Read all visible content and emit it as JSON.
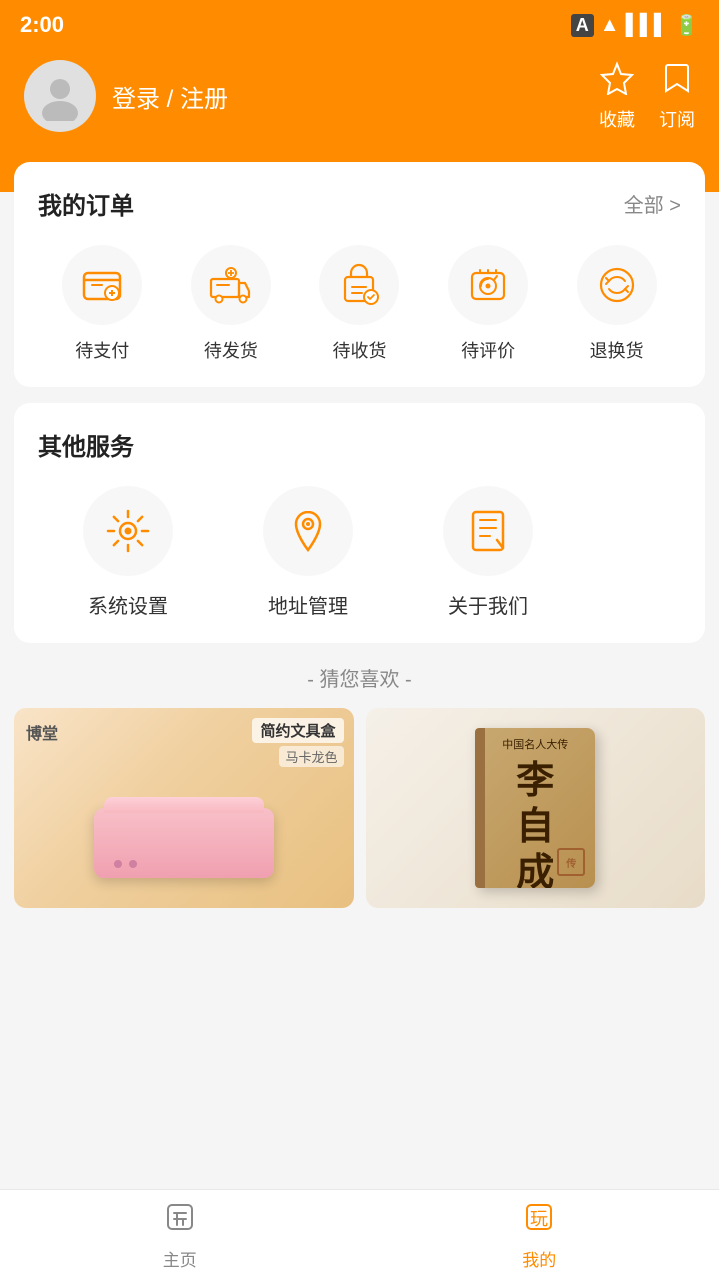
{
  "statusBar": {
    "time": "2:00",
    "icons": [
      "A",
      "wifi",
      "signal",
      "battery"
    ]
  },
  "header": {
    "loginText": "登录 / 注册",
    "favoriteLabel": "收藏",
    "subscribeLabel": "订阅"
  },
  "myOrders": {
    "title": "我的订单",
    "moreLabel": "全部 >",
    "items": [
      {
        "id": "pending-payment",
        "label": "待支付"
      },
      {
        "id": "pending-ship",
        "label": "待发货"
      },
      {
        "id": "pending-receive",
        "label": "待收货"
      },
      {
        "id": "pending-review",
        "label": "待评价"
      },
      {
        "id": "return-exchange",
        "label": "退换货"
      }
    ]
  },
  "otherServices": {
    "title": "其他服务",
    "items": [
      {
        "id": "system-settings",
        "label": "系统设置"
      },
      {
        "id": "address-management",
        "label": "地址管理"
      },
      {
        "id": "about-us",
        "label": "关于我们"
      }
    ]
  },
  "recommendations": {
    "title": "- 猜您喜欢 -",
    "products": [
      {
        "id": "pencil-box",
        "brandTag": "博堂",
        "name": "简约文具盒",
        "color": "马卡龙色"
      },
      {
        "id": "book-li-zicheng",
        "seriesTop": "中国名人大传",
        "titleLine1": "李",
        "titleLine2": "自",
        "titleLine3": "成"
      }
    ]
  },
  "bottomNav": {
    "items": [
      {
        "id": "home",
        "label": "主页",
        "active": false
      },
      {
        "id": "mine",
        "label": "我的",
        "active": true
      }
    ]
  },
  "colors": {
    "orange": "#FF8C00",
    "lightGray": "#f7f7f7"
  }
}
